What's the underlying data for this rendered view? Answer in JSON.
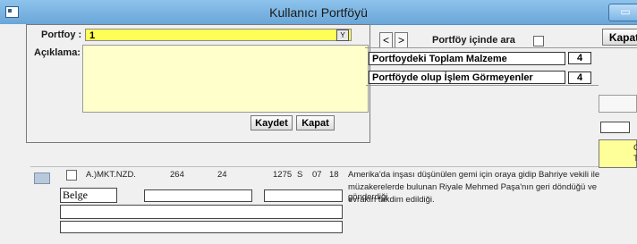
{
  "window": {
    "title": "Kullanıcı Portföyü",
    "minimize_label": "▭"
  },
  "form": {
    "portfoy_label": "Portfoy :",
    "portfoy_value": "1",
    "y_button": "Y",
    "aciklama_label": "Açıklama:",
    "kaydet_label": "Kaydet",
    "kapat_label": "Kapat"
  },
  "toolbar": {
    "prev_label": "<",
    "next_label": ">",
    "search_label": "Portföy içinde ara",
    "kapat_label": "Kapat"
  },
  "summary": {
    "toplam_label": "Portfoydeki Toplam Malzeme",
    "toplam_value": "4",
    "islem_label": "Portföyde olup İşlem Görmeyenler",
    "islem_value": "4"
  },
  "record": {
    "code": "A.)MKT.NZD.",
    "n1": "264",
    "n2": "24",
    "n3": "1275",
    "s": "S",
    "n4": "07",
    "n5": "18",
    "desc_line1": "Amerika'da inşası düşünülen gemi için oraya gidip Bahriye vekili ile",
    "desc_line2": "müzakerelerde bulunan Riyale Mehmed Paşa'nın geri döndüğü ve gönderdiği",
    "desc_line3": "evrakın takdim edildiği.",
    "belge_label": "Belge"
  },
  "right_grid": {
    "c1": "C",
    "c2": "T"
  },
  "colors": {
    "title_bar": "#8dc3ec",
    "input_yellow": "#ffff55",
    "area_yellow": "#ffffcc",
    "window_bg": "#f0f0f0"
  }
}
